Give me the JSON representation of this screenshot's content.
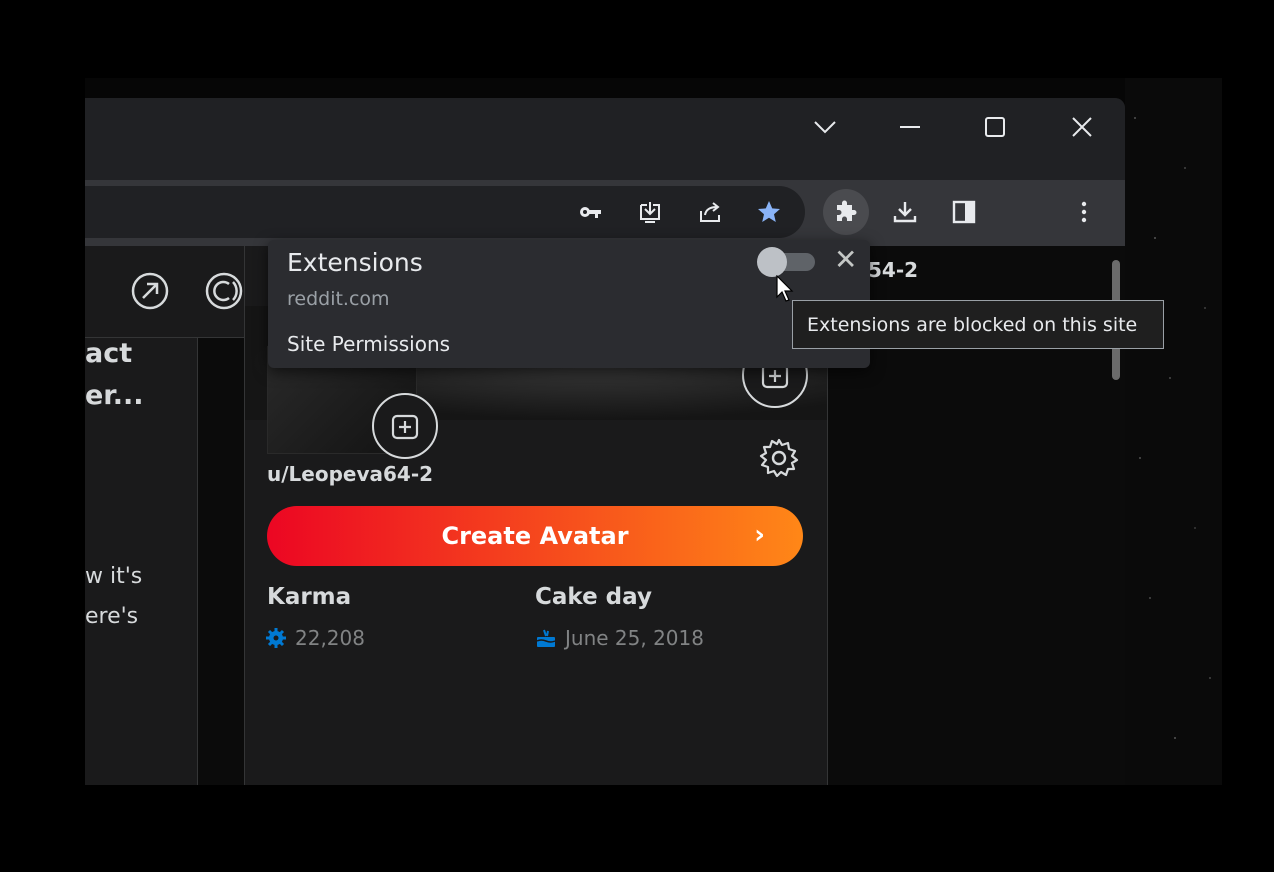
{
  "window": {
    "dropdown_icon": "chevron-down-icon",
    "minimize_icon": "minimize-icon",
    "maximize_icon": "maximize-icon",
    "close_icon": "close-icon"
  },
  "toolbar": {
    "icons": [
      "key-icon",
      "install-app-icon",
      "share-icon",
      "bookmark-star-icon",
      "extensions-puzzle-icon",
      "download-icon",
      "side-panel-icon",
      "profile-avatar",
      "menu-kebab-icon"
    ],
    "accent": "#8ab4f8"
  },
  "page": {
    "left_fragments": [
      "act",
      "er...",
      "w it's",
      "ere's"
    ],
    "right_fragment": "54-2",
    "profile": {
      "username": "u/Leopeva64-2",
      "create_avatar_label": "Create Avatar",
      "create_avatar_chevron": "›",
      "karma_label": "Karma",
      "karma_value": "22,208",
      "cakeday_label": "Cake day",
      "cakeday_value": "June 25, 2018"
    },
    "colors": {
      "create_start": "#ec0623",
      "create_end": "#ff8717",
      "stat_icon": "#0079d3"
    }
  },
  "extensions_popup": {
    "title": "Extensions",
    "site": "reddit.com",
    "permissions_label": "Site Permissions",
    "toggle_on": false,
    "close_glyph": "✕"
  },
  "tooltip": {
    "text": "Extensions are blocked on this site"
  }
}
